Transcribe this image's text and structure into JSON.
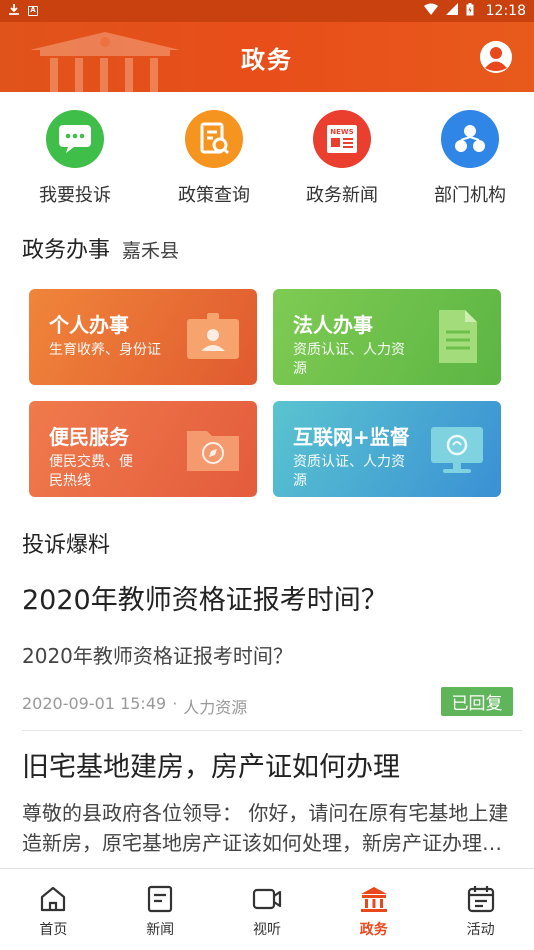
{
  "status_bar": {
    "time": "12:18"
  },
  "header": {
    "title": "政务"
  },
  "quick_links": [
    {
      "label": "我要投诉",
      "icon": "chat-icon",
      "color": "#3fbf4a"
    },
    {
      "label": "政策查询",
      "icon": "document-search-icon",
      "color": "#f5941e"
    },
    {
      "label": "政务新闻",
      "icon": "news-icon",
      "color": "#ea3e2f",
      "badge": "NEWS"
    },
    {
      "label": "部门机构",
      "icon": "organization-icon",
      "color": "#2f86e6"
    }
  ],
  "gov_section": {
    "title": "政务办事",
    "region": "嘉禾县"
  },
  "service_cards": [
    {
      "title": "个人办事",
      "desc": "生育收养、身份证"
    },
    {
      "title": "法人办事",
      "desc": "资质认证、人力资源"
    },
    {
      "title": "便民服务",
      "desc": "便民交费、便民热线"
    },
    {
      "title": "互联网+监督",
      "desc": "资质认证、人力资源"
    }
  ],
  "complaints": {
    "title": "投诉爆料",
    "posts": [
      {
        "title": "2020年教师资格证报考时间？",
        "body": "2020年教师资格证报考时间？",
        "date": "2020-09-01 15:49",
        "separator": "·",
        "dept": "人力资源",
        "status": "已回复"
      },
      {
        "title": "旧宅基地建房，房产证如何办理",
        "body": "尊敬的县政府各位领导：   你好，请问在原有宅基地上建造新房，原宅基地房产证该如何处理，新房产证办理需要哪些手续？"
      }
    ]
  },
  "bottom_nav": [
    {
      "label": "首页",
      "icon": "home-icon"
    },
    {
      "label": "新闻",
      "icon": "news-list-icon"
    },
    {
      "label": "视听",
      "icon": "video-icon"
    },
    {
      "label": "政务",
      "icon": "government-icon",
      "active": true
    },
    {
      "label": "活动",
      "icon": "calendar-icon"
    }
  ],
  "colors": {
    "accent": "#e8481c",
    "replied": "#5fb55a"
  }
}
